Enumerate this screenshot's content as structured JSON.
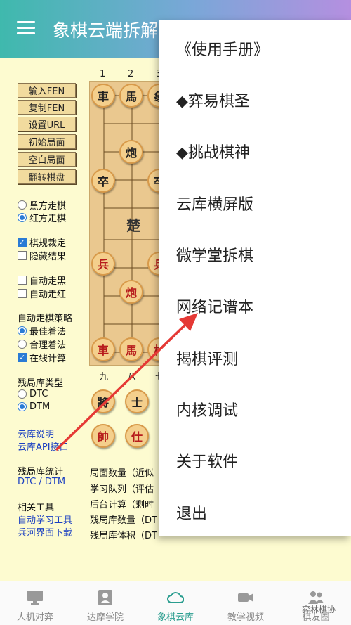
{
  "header": {
    "title": "象棋云端拆解专"
  },
  "controls": {
    "buttons": [
      "输入FEN",
      "复制FEN",
      "设置URL",
      "初始局面",
      "空白局面",
      "翻转棋盘"
    ],
    "side_black": "黑方走棋",
    "side_red": "红方走棋",
    "rule_judge": "棋规裁定",
    "hide_result": "隐藏结果",
    "auto_black": "自动走黑",
    "auto_red": "自动走红",
    "strategy_title": "自动走棋策略",
    "best_move": "最佳着法",
    "reasonable_move": "合理着法",
    "online_calc": "在线计算",
    "endgame_type_title": "残局库类型",
    "dtc": "DTC",
    "dtm": "DTM",
    "cloud_desc": "云库说明",
    "cloud_api": "云库API接口",
    "endgame_stats": "残局库统计",
    "dtc_dtm": "DTC / DTM",
    "tools_title": "相关工具",
    "auto_learn": "自动学习工具",
    "bhm_download": "兵河界面下载"
  },
  "board": {
    "top_numbers": [
      "1",
      "2",
      "3"
    ],
    "bottom_numbers": [
      "九",
      "八",
      "七"
    ],
    "river_text": "楚",
    "pieces_top": [
      "車",
      "馬",
      "象",
      "炮",
      "卒",
      "卒"
    ],
    "pieces_bottom": [
      "兵",
      "兵",
      "炮",
      "車",
      "馬",
      "相"
    ],
    "captured": [
      "將",
      "士",
      "帥",
      "仕"
    ]
  },
  "stats": [
    "局面数量（近似",
    "学习队列（评估",
    "后台计算（剩时",
    "残局库数量（DT",
    "残局库体积（DT"
  ],
  "menu": {
    "items": [
      "《使用手册》",
      "◆弈易棋圣",
      "◆挑战棋神",
      "云库横屏版",
      "微学堂拆棋",
      "网络记谱本",
      "揭棋评测",
      "内核调试",
      "关于软件",
      "退出"
    ]
  },
  "nav": {
    "items": [
      "人机对弈",
      "达摩学院",
      "象棋云库",
      "教学视频",
      "棋友圈"
    ],
    "active_index": 2
  },
  "watermark": "弈林棋协",
  "colors": {
    "accent": "#2a9d8f",
    "arrow": "#e53935",
    "link": "#1a3fc2"
  }
}
